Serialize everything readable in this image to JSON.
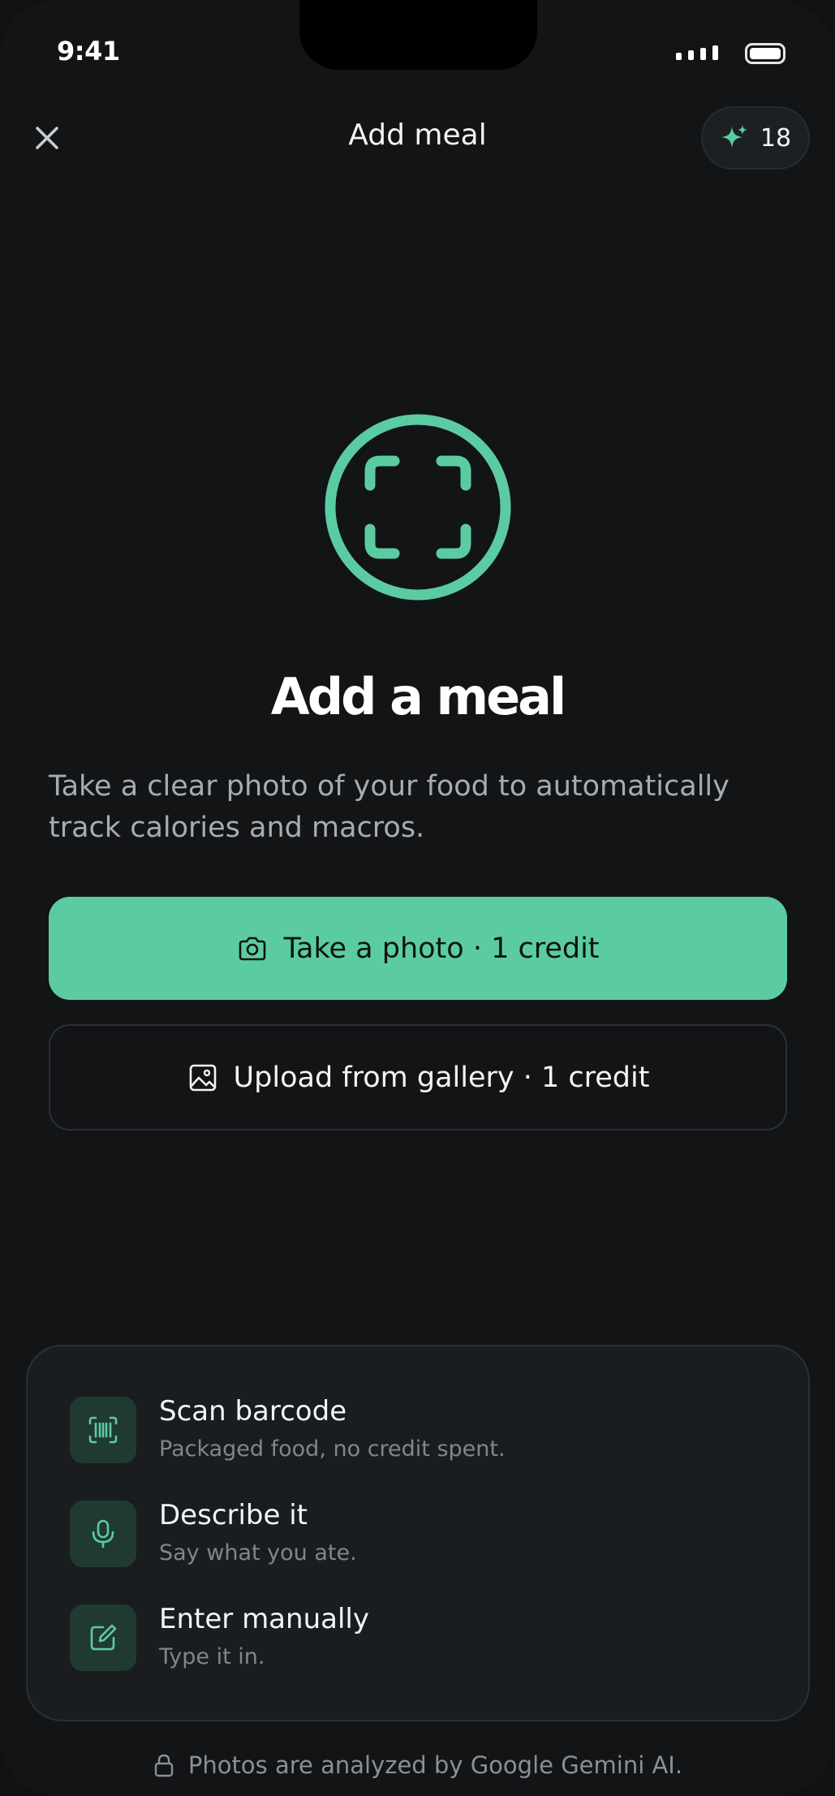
{
  "status_bar": {
    "time": "9:41"
  },
  "header": {
    "title": "Add meal",
    "credits": "18",
    "close_icon": "close-icon",
    "credits_icon": "sparkles-icon"
  },
  "hero": {
    "icon": "scan-frame-icon",
    "title": "Add a meal",
    "description": "Take a clear photo of your food to automatically track calories and macros."
  },
  "actions": {
    "take_photo": {
      "label": "Take a photo · 1 credit",
      "icon": "camera-icon"
    },
    "upload": {
      "label": "Upload from gallery · 1 credit",
      "icon": "image-icon"
    }
  },
  "options": [
    {
      "title": "Scan barcode",
      "subtitle": "Packaged food, no credit spent.",
      "icon": "barcode-icon"
    },
    {
      "title": "Describe it",
      "subtitle": "Say what you ate.",
      "icon": "microphone-icon"
    },
    {
      "title": "Enter manually",
      "subtitle": "Type it in.",
      "icon": "edit-icon"
    }
  ],
  "footer": {
    "note": "Photos are analyzed by Google Gemini AI.",
    "icon": "lock-icon"
  },
  "colors": {
    "accent": "#5bcca2",
    "background": "#121416",
    "card": "#1a1d1f"
  }
}
